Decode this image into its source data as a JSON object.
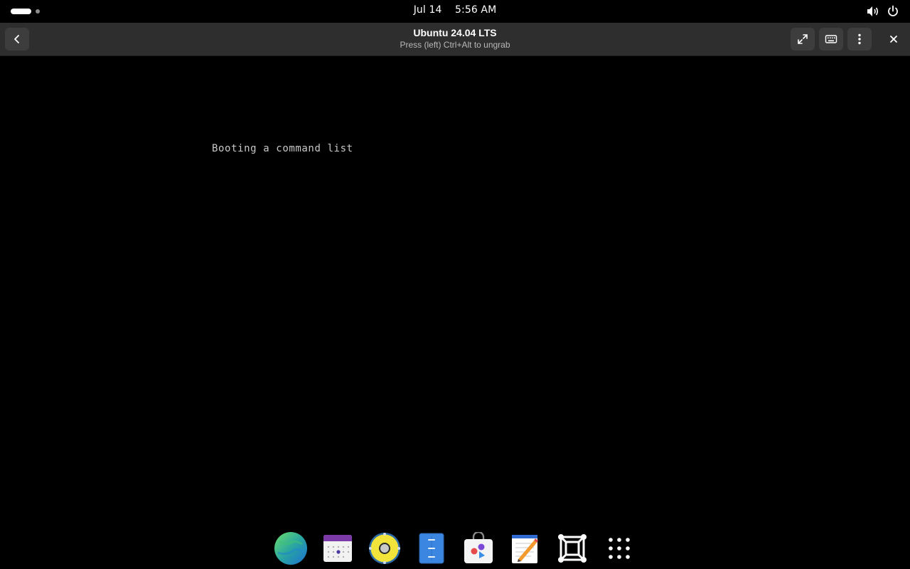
{
  "topbar": {
    "date": "Jul 14",
    "time": "5:56 AM",
    "icons": [
      "volume-icon",
      "power-icon"
    ]
  },
  "window": {
    "title": "Ubuntu 24.04 LTS",
    "subtitle": "Press (left) Ctrl+Alt to ungrab",
    "buttons": [
      "back-button",
      "fullscreen-button",
      "keyboard-button",
      "menu-button",
      "close-button"
    ]
  },
  "vm": {
    "console_text": "Booting a command list"
  },
  "dock": {
    "apps": [
      "web-browser-icon",
      "calendar-icon",
      "rhythmbox-icon",
      "files-icon",
      "software-icon",
      "text-editor-icon",
      "boxes-icon",
      "app-grid-icon"
    ]
  },
  "colors": {
    "header_bg": "#2e2e2e",
    "button_bg": "#3d3d3d",
    "screen_bg": "#000000"
  }
}
